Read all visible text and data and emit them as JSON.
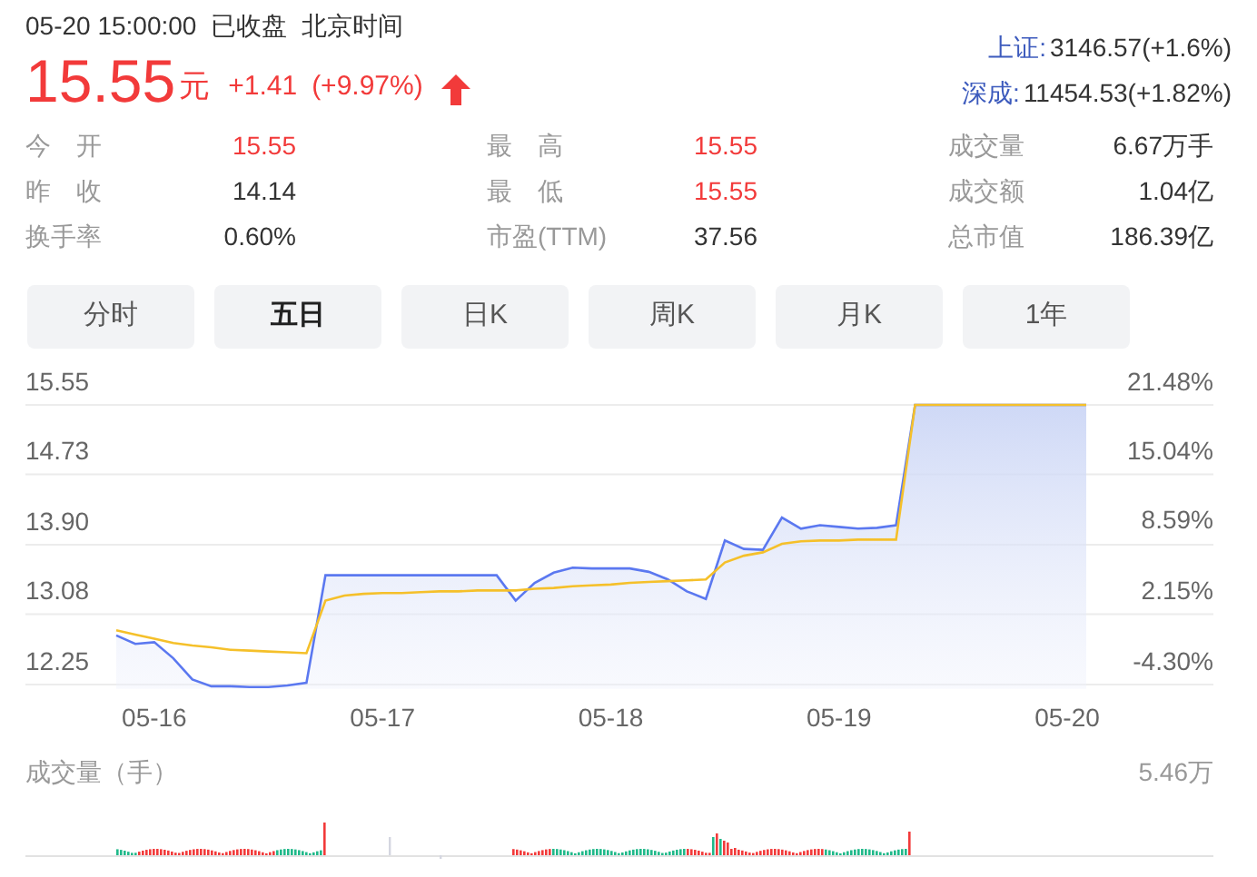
{
  "header": {
    "datetime": "05-20 15:00:00",
    "status": "已收盘",
    "timezone": "北京时间"
  },
  "price": {
    "value": "15.55",
    "unit": "元",
    "change": "+1.41",
    "change_pct": "(+9.97%)",
    "rising": true
  },
  "indices": [
    {
      "name": "上证:",
      "value": "3146.57(+1.6%)"
    },
    {
      "name": "深成:",
      "value": "11454.53(+1.82%)"
    }
  ],
  "stats": [
    [
      {
        "label": "今　开",
        "value": "15.55",
        "kind": "up"
      },
      {
        "label": "昨　收",
        "value": "14.14",
        "kind": "neutral"
      },
      {
        "label": "换手率",
        "value": "0.60%",
        "kind": "neutral"
      }
    ],
    [
      {
        "label": "最　高",
        "value": "15.55",
        "kind": "up"
      },
      {
        "label": "最　低",
        "value": "15.55",
        "kind": "up"
      },
      {
        "label": "市盈(TTM)",
        "value": "37.56",
        "kind": "neutral"
      }
    ],
    [
      {
        "label": "成交量",
        "value": "6.67万手",
        "kind": "neutral"
      },
      {
        "label": "成交额",
        "value": "1.04亿",
        "kind": "neutral"
      },
      {
        "label": "总市值",
        "value": "186.39亿",
        "kind": "neutral"
      }
    ]
  ],
  "tabs": [
    {
      "label": "分时",
      "selected": false
    },
    {
      "label": "五日",
      "selected": true
    },
    {
      "label": "日K",
      "selected": false
    },
    {
      "label": "周K",
      "selected": false
    },
    {
      "label": "月K",
      "selected": false
    },
    {
      "label": "1年",
      "selected": false
    }
  ],
  "chart": {
    "percent_labels": [
      "21.48%",
      "15.04%",
      "8.59%",
      "2.15%",
      "-4.30%"
    ],
    "chart_data": {
      "type": "line",
      "grid": true,
      "categories": [
        null,
        null,
        "05-16",
        null,
        null,
        null,
        null,
        null,
        null,
        null,
        null,
        null,
        null,
        null,
        "05-17",
        null,
        null,
        null,
        null,
        null,
        null,
        null,
        null,
        null,
        null,
        null,
        "05-18",
        null,
        null,
        null,
        null,
        null,
        null,
        null,
        null,
        null,
        null,
        null,
        "05-19",
        null,
        null,
        null,
        null,
        null,
        null,
        null,
        null,
        null,
        null,
        null,
        "05-20",
        null
      ],
      "ylim": [
        12.2,
        15.55
      ],
      "yticks": [
        {
          "value": 15.55,
          "label": "15.55"
        },
        {
          "value": 14.73,
          "label": "14.73"
        },
        {
          "value": 13.9,
          "label": "13.90"
        },
        {
          "value": 13.08,
          "label": "13.08"
        },
        {
          "value": 12.25,
          "label": "12.25"
        }
      ],
      "series": [
        {
          "type": "area",
          "color": "#5b78f0",
          "values": [
            12.83,
            12.73,
            12.75,
            12.56,
            12.31,
            12.23,
            12.23,
            12.22,
            12.22,
            12.24,
            12.27,
            13.54,
            13.54,
            13.54,
            13.54,
            13.54,
            13.54,
            13.54,
            13.54,
            13.54,
            13.54,
            13.24,
            13.45,
            13.57,
            13.63,
            13.62,
            13.62,
            13.62,
            13.58,
            13.49,
            13.35,
            13.26,
            13.95,
            13.85,
            13.84,
            14.22,
            14.09,
            14.13,
            14.11,
            14.09,
            14.1,
            14.13,
            15.55,
            15.55,
            15.55,
            15.55,
            15.55,
            15.55,
            15.55,
            15.55,
            15.55,
            15.55
          ]
        },
        {
          "color": "#f5c02a",
          "values": [
            12.89,
            12.84,
            12.79,
            12.74,
            12.71,
            12.69,
            12.66,
            12.65,
            12.64,
            12.63,
            12.62,
            13.24,
            13.3,
            13.32,
            13.33,
            13.33,
            13.34,
            13.35,
            13.35,
            13.36,
            13.36,
            13.36,
            13.38,
            13.39,
            13.41,
            13.42,
            13.43,
            13.45,
            13.46,
            13.47,
            13.48,
            13.49,
            13.69,
            13.77,
            13.81,
            13.91,
            13.94,
            13.95,
            13.95,
            13.96,
            13.96,
            13.96,
            15.55,
            15.55,
            15.55,
            15.55,
            15.55,
            15.55,
            15.55,
            15.55,
            15.55,
            15.55
          ]
        }
      ]
    }
  },
  "volume": {
    "title": "成交量（手）",
    "max_label": "5.46万"
  }
}
